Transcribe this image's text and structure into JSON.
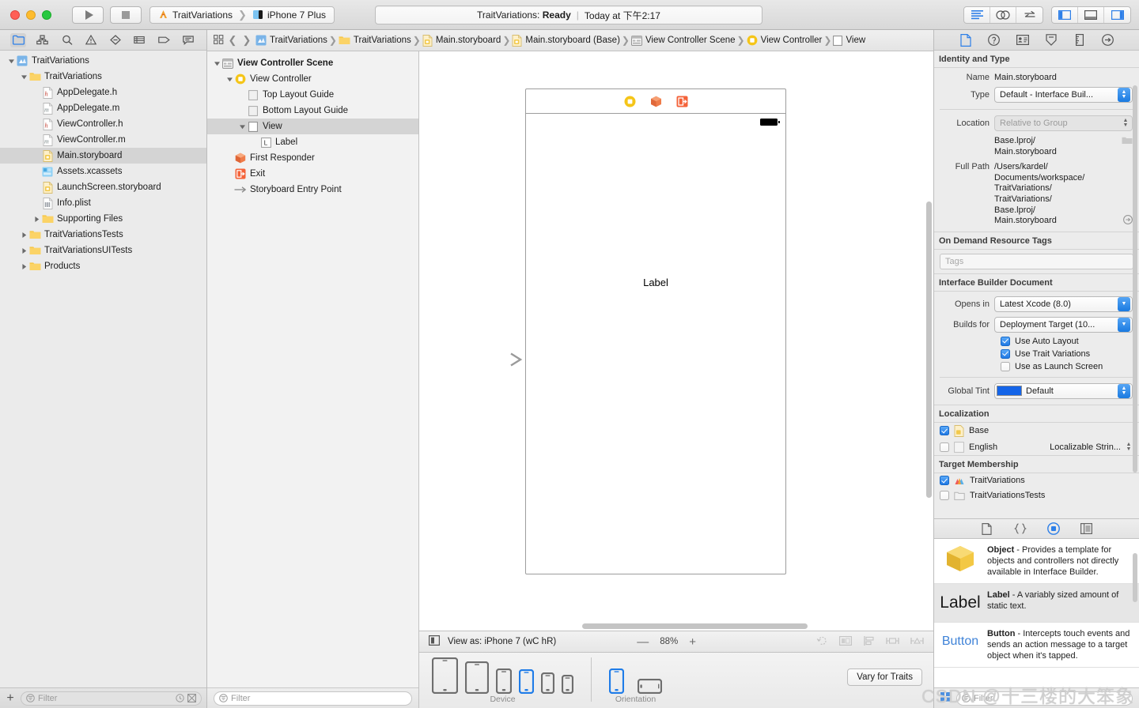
{
  "toolbar": {
    "scheme": "TraitVariations",
    "destination": "iPhone 7 Plus",
    "status_project": "TraitVariations:",
    "status_state": "Ready",
    "status_time": "Today at 下午2:17",
    "run_label": "Run",
    "stop_label": "Stop"
  },
  "navigator": {
    "tabs": [
      "folder-icon",
      "sitemap-icon",
      "search-icon",
      "warning-icon",
      "breakpoint-icon",
      "report-icon",
      "tag-icon",
      "comment-icon"
    ],
    "items": [
      {
        "label": "TraitVariations",
        "indent": 0,
        "icon": "project-icon",
        "twisty": "down",
        "selected": false
      },
      {
        "label": "TraitVariations",
        "indent": 1,
        "icon": "folder-icon",
        "twisty": "down",
        "selected": false
      },
      {
        "label": "AppDelegate.h",
        "indent": 2,
        "icon": "header-icon",
        "twisty": "",
        "selected": false
      },
      {
        "label": "AppDelegate.m",
        "indent": 2,
        "icon": "source-icon",
        "twisty": "",
        "selected": false
      },
      {
        "label": "ViewController.h",
        "indent": 2,
        "icon": "header-icon",
        "twisty": "",
        "selected": false
      },
      {
        "label": "ViewController.m",
        "indent": 2,
        "icon": "source-icon",
        "twisty": "",
        "selected": false
      },
      {
        "label": "Main.storyboard",
        "indent": 2,
        "icon": "storyboard-icon",
        "twisty": "",
        "selected": true
      },
      {
        "label": "Assets.xcassets",
        "indent": 2,
        "icon": "assets-icon",
        "twisty": "",
        "selected": false
      },
      {
        "label": "LaunchScreen.storyboard",
        "indent": 2,
        "icon": "storyboard-icon",
        "twisty": "",
        "selected": false
      },
      {
        "label": "Info.plist",
        "indent": 2,
        "icon": "plist-icon",
        "twisty": "",
        "selected": false
      },
      {
        "label": "Supporting Files",
        "indent": 2,
        "icon": "folder-icon",
        "twisty": "right",
        "selected": false
      },
      {
        "label": "TraitVariationsTests",
        "indent": 1,
        "icon": "folder-icon",
        "twisty": "right",
        "selected": false
      },
      {
        "label": "TraitVariationsUITests",
        "indent": 1,
        "icon": "folder-icon",
        "twisty": "right",
        "selected": false
      },
      {
        "label": "Products",
        "indent": 1,
        "icon": "folder-icon",
        "twisty": "right",
        "selected": false
      }
    ],
    "filter_placeholder": "Filter",
    "add_label": "+"
  },
  "jumpbar": {
    "crumbs": [
      {
        "label": "TraitVariations",
        "icon": "project-icon"
      },
      {
        "label": "TraitVariations",
        "icon": "folder-icon"
      },
      {
        "label": "Main.storyboard",
        "icon": "storyboard-icon"
      },
      {
        "label": "Main.storyboard (Base)",
        "icon": "storyboard-icon"
      },
      {
        "label": "View Controller Scene",
        "icon": "scene-icon"
      },
      {
        "label": "View Controller",
        "icon": "viewcontroller-icon"
      },
      {
        "label": "View",
        "icon": "view-icon"
      }
    ]
  },
  "outline": {
    "items": [
      {
        "label": "View Controller Scene",
        "indent": 0,
        "icon": "scene-icon",
        "twisty": "down",
        "bold": true,
        "selected": false
      },
      {
        "label": "View Controller",
        "indent": 1,
        "icon": "viewcontroller-icon",
        "twisty": "down",
        "bold": false,
        "selected": false
      },
      {
        "label": "Top Layout Guide",
        "indent": 2,
        "icon": "guide-icon",
        "twisty": "",
        "bold": false,
        "selected": false
      },
      {
        "label": "Bottom Layout Guide",
        "indent": 2,
        "icon": "guide-icon",
        "twisty": "",
        "bold": false,
        "selected": false
      },
      {
        "label": "View",
        "indent": 2,
        "icon": "view-icon",
        "twisty": "down",
        "bold": false,
        "selected": true
      },
      {
        "label": "Label",
        "indent": 3,
        "icon": "label-icon",
        "twisty": "",
        "bold": false,
        "selected": false
      },
      {
        "label": "First Responder",
        "indent": 1,
        "icon": "firstresponder-icon",
        "twisty": "",
        "bold": false,
        "selected": false
      },
      {
        "label": "Exit",
        "indent": 1,
        "icon": "exit-icon",
        "twisty": "",
        "bold": false,
        "selected": false
      },
      {
        "label": "Storyboard Entry Point",
        "indent": 1,
        "icon": "entrypoint-icon",
        "twisty": "",
        "bold": false,
        "selected": false
      }
    ],
    "filter_placeholder": "Filter"
  },
  "canvas": {
    "label_text": "Label",
    "dock_icons": [
      "viewcontroller-icon",
      "firstresponder-icon",
      "exit-icon"
    ],
    "view_as": "View as: iPhone 7 (wC hR)",
    "zoom": "88%",
    "zoom_out": "—",
    "zoom_in": "+",
    "device_label": "Device",
    "orientation_label": "Orientation",
    "vary_button": "Vary for Traits",
    "selected_device_index": 3,
    "selected_orientation_index": 0
  },
  "inspector": {
    "tabs": [
      "file-inspector-icon",
      "quick-help-icon",
      "identity-inspector-icon",
      "attributes-inspector-icon",
      "size-inspector-icon",
      "connections-inspector-icon"
    ],
    "identity_and_type": {
      "header": "Identity and Type",
      "name_label": "Name",
      "name_value": "Main.storyboard",
      "type_label": "Type",
      "type_value": "Default - Interface Buil...",
      "location_label": "Location",
      "location_value": "Relative to Group",
      "relative_path": "Base.lproj/\nMain.storyboard",
      "full_path_label": "Full Path",
      "full_path_value": "/Users/kardel/\nDocuments/workspace/\nTraitVariations/\nTraitVariations/\nBase.lproj/\nMain.storyboard"
    },
    "on_demand": {
      "header": "On Demand Resource Tags",
      "tags_placeholder": "Tags"
    },
    "ib_document": {
      "header": "Interface Builder Document",
      "opens_in_label": "Opens in",
      "opens_in_value": "Latest Xcode (8.0)",
      "builds_for_label": "Builds for",
      "builds_for_value": "Deployment Target (10...",
      "checkboxes": [
        {
          "label": "Use Auto Layout",
          "checked": true
        },
        {
          "label": "Use Trait Variations",
          "checked": true
        },
        {
          "label": "Use as Launch Screen",
          "checked": false
        }
      ],
      "global_tint_label": "Global Tint",
      "global_tint_value": "Default",
      "global_tint_color": "#1565e8"
    },
    "localization": {
      "header": "Localization",
      "rows": [
        {
          "label": "Base",
          "checked": true,
          "trailing": ""
        },
        {
          "label": "English",
          "checked": false,
          "trailing": "Localizable Strin..."
        }
      ]
    },
    "target_membership": {
      "header": "Target Membership",
      "rows": [
        {
          "label": "TraitVariations",
          "checked": true
        },
        {
          "label": "TraitVariationsTests",
          "checked": false
        }
      ]
    }
  },
  "library": {
    "tabs": [
      "file-template-icon",
      "code-snippet-icon",
      "object-library-icon",
      "media-library-icon"
    ],
    "items": [
      {
        "thumb": "object-cube",
        "title": "Object",
        "desc": " - Provides a template for objects and controllers not directly available in Interface Builder.",
        "selected": false
      },
      {
        "thumb": "label-text",
        "title": "Label",
        "desc": " - A variably sized amount of static text.",
        "selected": true
      },
      {
        "thumb": "button-text",
        "title": "Button",
        "desc": " - Intercepts touch events and sends an action message to a target object when it's tapped.",
        "selected": false
      }
    ],
    "filter_placeholder": "Filter"
  },
  "watermark": "CSDN @十三楼的大笨象"
}
